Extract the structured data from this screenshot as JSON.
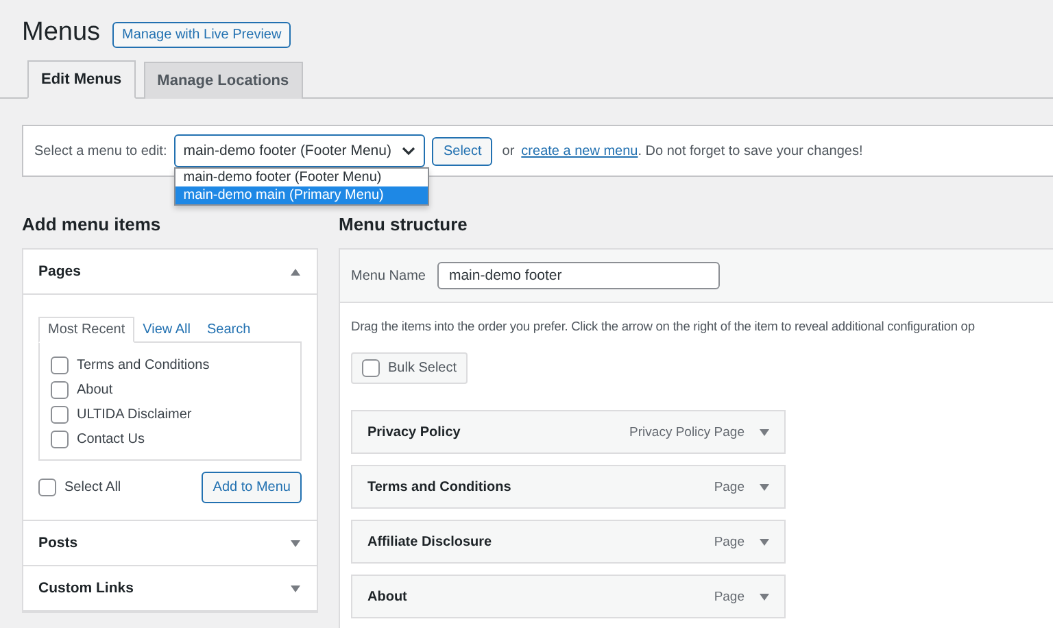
{
  "title": "Menus",
  "live_preview_button": "Manage with Live Preview",
  "tabs": [
    {
      "label": "Edit Menus",
      "selected": true
    },
    {
      "label": "Manage Locations",
      "selected": false
    }
  ],
  "select_bar": {
    "label": "Select a menu to edit:",
    "value": "main-demo footer (Footer Menu)",
    "button": "Select",
    "text_before_link": "or",
    "link": "create a new menu",
    "text_after_link": ". Do not forget to save your changes!",
    "options": [
      {
        "label": "main-demo footer (Footer Menu)",
        "highlighted": false
      },
      {
        "label": "main-demo main (Primary Menu)",
        "highlighted": true
      }
    ]
  },
  "add_menu_items": {
    "heading": "Add menu items",
    "sections": [
      {
        "title": "Pages",
        "expanded": true,
        "tabs": [
          {
            "label": "Most Recent",
            "selected": true
          },
          {
            "label": "View All",
            "selected": false
          },
          {
            "label": "Search",
            "selected": false
          }
        ],
        "pages": [
          {
            "label": "Terms and Conditions",
            "checked": false
          },
          {
            "label": "About",
            "checked": false
          },
          {
            "label": "ULTIDA Disclaimer",
            "checked": false
          },
          {
            "label": "Contact Us",
            "checked": false
          }
        ],
        "select_all": {
          "label": "Select All",
          "checked": false
        },
        "add_button": "Add to Menu"
      },
      {
        "title": "Posts",
        "expanded": false
      },
      {
        "title": "Custom Links",
        "expanded": false
      }
    ]
  },
  "menu_structure": {
    "heading": "Menu structure",
    "name_label": "Menu Name",
    "name_value": "main-demo footer",
    "instructions": "Drag the items into the order you prefer. Click the arrow on the right of the item to reveal additional configuration op",
    "bulk_select": {
      "label": "Bulk Select",
      "checked": false
    },
    "items": [
      {
        "title": "Privacy Policy",
        "type": "Privacy Policy Page"
      },
      {
        "title": "Terms and Conditions",
        "type": "Page"
      },
      {
        "title": "Affiliate Disclosure",
        "type": "Page"
      },
      {
        "title": "About",
        "type": "Page"
      }
    ]
  }
}
